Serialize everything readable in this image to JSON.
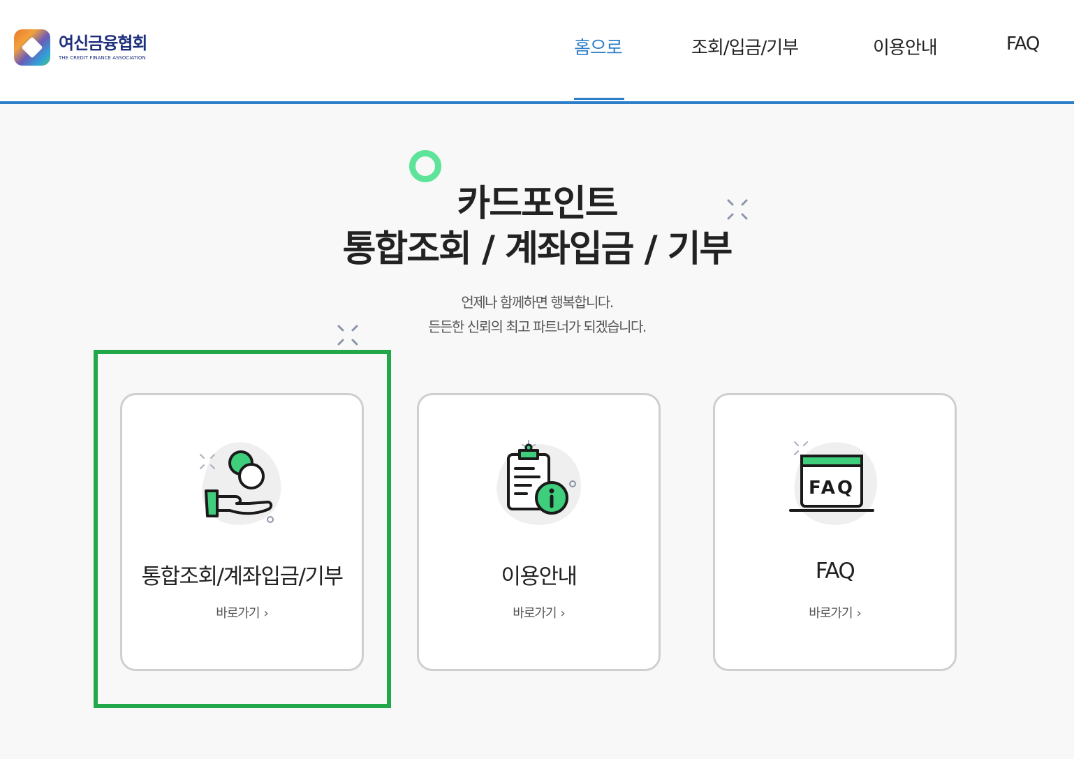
{
  "logo": {
    "title": "여신금융협회",
    "subtitle": "THE CREDIT FINANCE ASSOCIATION"
  },
  "nav": {
    "items": [
      {
        "label": "홈으로",
        "active": true
      },
      {
        "label": "조회/입금/기부",
        "active": false
      },
      {
        "label": "이용안내",
        "active": false
      },
      {
        "label": "FAQ",
        "active": false
      }
    ]
  },
  "hero": {
    "title_line1": "카드포인트",
    "title_line2": "통합조회 / 계좌입금 / 기부",
    "subtitle_line1": "언제나 함께하면 행복합니다.",
    "subtitle_line2": "든든한 신뢰의 최고 파트너가 되겠습니다."
  },
  "cards": [
    {
      "title": "통합조회/계좌입금/기부",
      "link": "바로가기",
      "icon": "hand-coin-icon",
      "highlighted": true
    },
    {
      "title": "이용안내",
      "link": "바로가기",
      "icon": "clipboard-info-icon",
      "highlighted": false
    },
    {
      "title": "FAQ",
      "link": "바로가기",
      "icon": "faq-window-icon",
      "highlighted": false
    }
  ],
  "icon_labels": {
    "faq": "FAQ"
  },
  "colors": {
    "accent_blue": "#2e7ec9",
    "accent_green": "#3fcf7c",
    "highlight_green": "#22a84a",
    "logo_navy": "#1e2f7d"
  }
}
